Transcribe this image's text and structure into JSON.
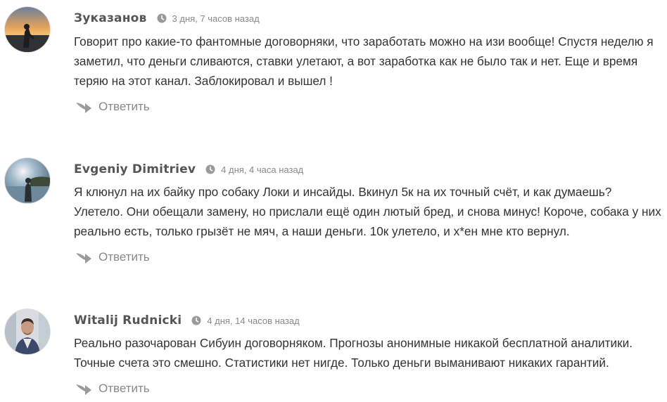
{
  "colors": {
    "author": "#555555",
    "meta": "#888888",
    "text": "#333333",
    "icon": "#9a9a9a"
  },
  "comments": [
    {
      "author": "Зуказанов",
      "time": "3 дня, 7 часов назад",
      "text": "Говорит про какие-то фантомные договорняки, что заработать можно на изи вообще! Спустя неделю я заметил, что деньги сливаются, ставки улетают, а вот заработка как не было так и нет. Еще и время теряю на этот канал. Заблокировал и вышел !",
      "reply_label": "Ответить"
    },
    {
      "author": "Evgeniy Dimitriev",
      "time": "4 дня, 4 часа назад",
      "text": "Я клюнул на их байку про собаку Локи и инсайды. Вкинул 5к на их точный счёт, и как думаешь? Улетело. Они обещали замену, но прислали ещё один лютый бред, и снова минус! Короче, собака у них реально есть, только грызёт не мяч, а наши деньги. 10к улетело, и х*ен мне кто вернул.",
      "reply_label": "Ответить"
    },
    {
      "author": "Witalij Rudnicki",
      "time": "4 дня, 14 часов назад",
      "text": "Реально разочарован Сибуин договорняком. Прогнозы анонимные никакой бесплатной аналитики. Точные счета это смешно. Статистики нет нигде. Только деньги выманивают никаких гарантий.",
      "reply_label": "Ответить"
    }
  ]
}
